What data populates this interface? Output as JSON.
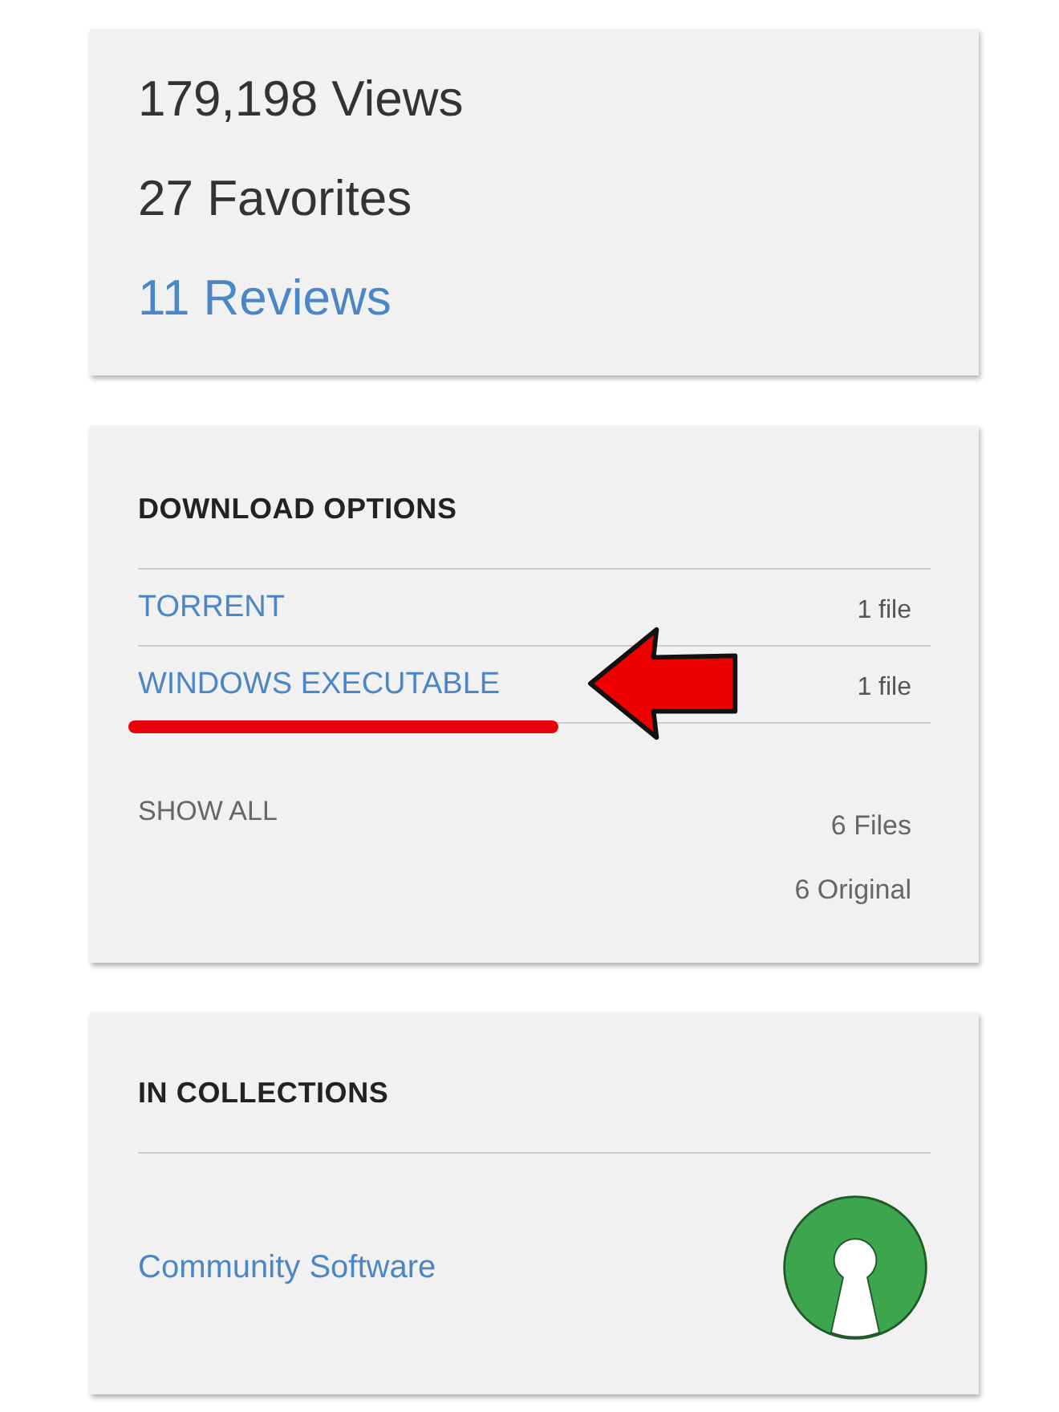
{
  "stats": [
    {
      "text": "179,198 Views",
      "kind": "plain"
    },
    {
      "text": "27 Favorites",
      "kind": "plain"
    },
    {
      "text": "11 Reviews",
      "kind": "link"
    }
  ],
  "download_options": {
    "title": "DOWNLOAD OPTIONS",
    "options": [
      {
        "label": "TORRENT",
        "count": "1 file",
        "annotated": false
      },
      {
        "label": "WINDOWS EXECUTABLE",
        "count": "1 file",
        "annotated": true
      }
    ],
    "show_all": "SHOW ALL",
    "totals": [
      "6 Files",
      "6 Original"
    ]
  },
  "collections": {
    "title": "IN COLLECTIONS",
    "items": [
      {
        "label": "Community Software"
      }
    ]
  }
}
